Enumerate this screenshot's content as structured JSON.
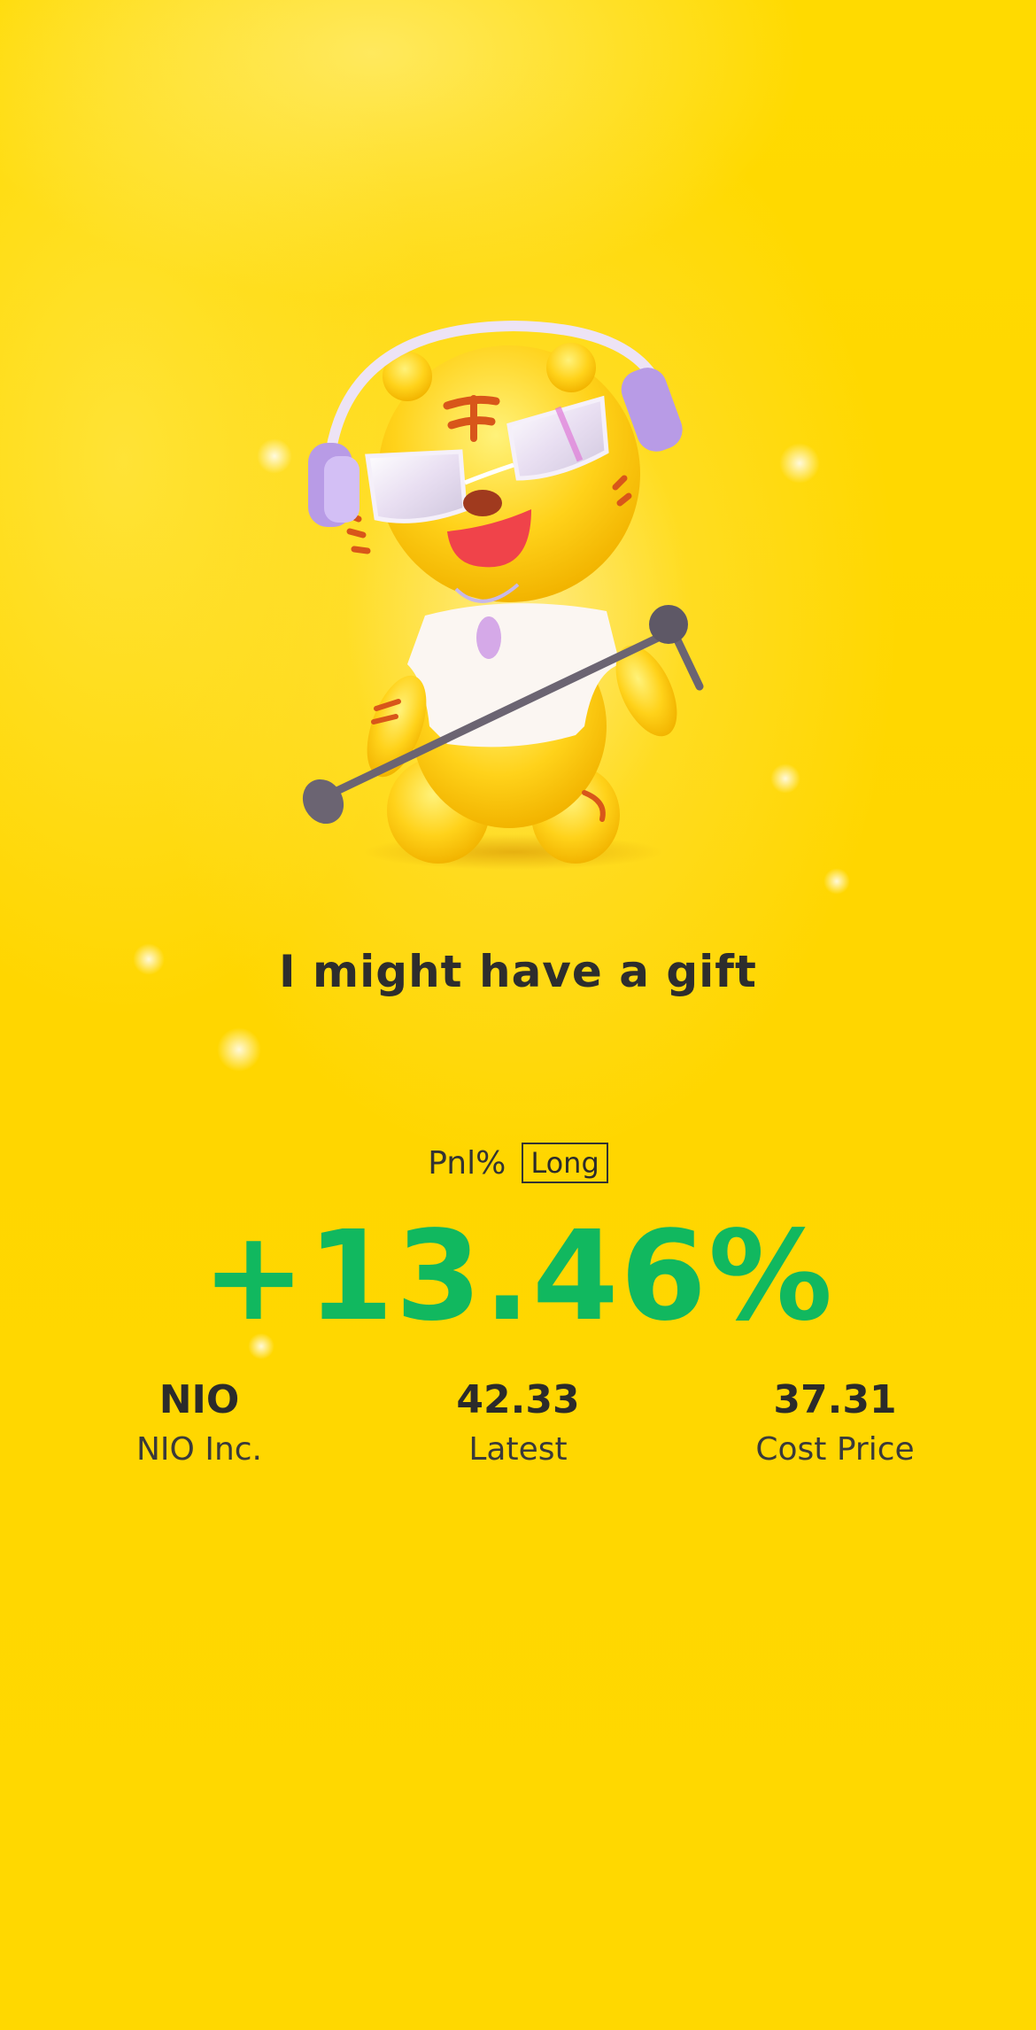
{
  "headline": "I might have a gift",
  "pnl": {
    "label": "Pnl%",
    "position_tag": "Long",
    "value": "+13.46%"
  },
  "stats": [
    {
      "value": "NIO",
      "label": "NIO Inc."
    },
    {
      "value": "42.33",
      "label": "Latest"
    },
    {
      "value": "37.31",
      "label": "Cost Price"
    }
  ],
  "colors": {
    "background": "#FFD900",
    "gain": "#11B85F",
    "text": "#2D2D2D"
  },
  "illustration": "tiger-mascot-with-headphones-and-microphone"
}
